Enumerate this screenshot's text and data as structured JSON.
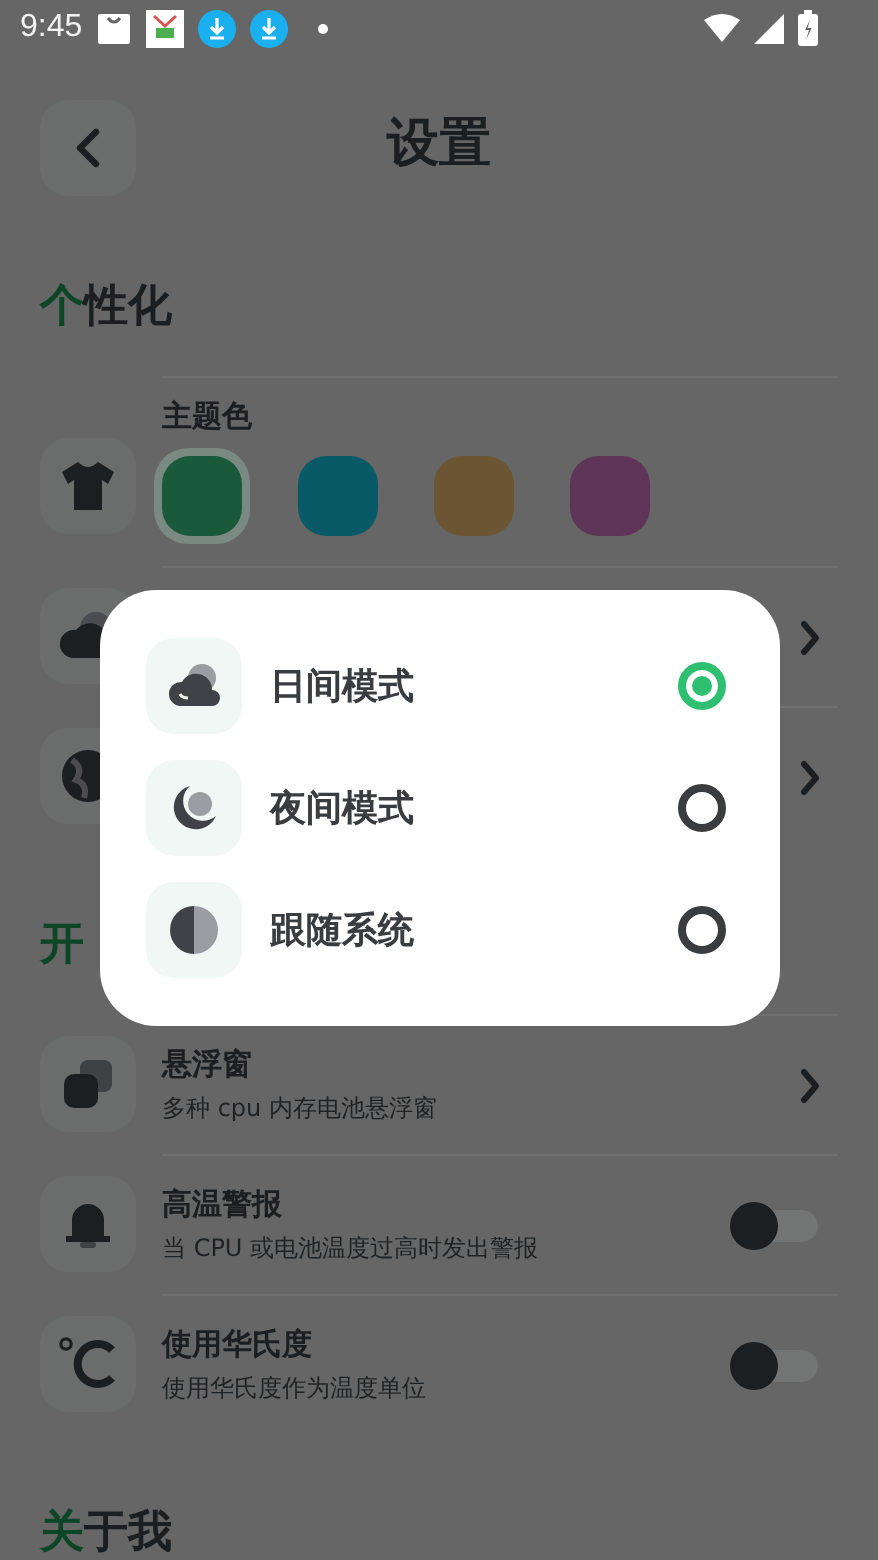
{
  "status_bar": {
    "time": "9:45"
  },
  "header": {
    "title": "设置"
  },
  "sections": [
    {
      "title_accent": "个",
      "title_rest": "性化",
      "rows": [
        {
          "kind": "colors",
          "label": "主题色",
          "swatches": [
            {
              "color": "#1a5a3a",
              "selected": true
            },
            {
              "color": "#075a66",
              "selected": false
            },
            {
              "color": "#6b5533",
              "selected": false
            },
            {
              "color": "#5e3558",
              "selected": false
            }
          ]
        },
        {
          "kind": "nav"
        },
        {
          "kind": "nav"
        }
      ]
    },
    {
      "title_accent": "开",
      "rows": [
        {
          "kind": "nav",
          "title": "悬浮窗",
          "subtitle": "多种 cpu 内存电池悬浮窗"
        },
        {
          "kind": "toggle",
          "title": "高温警报",
          "subtitle": "当 CPU 或电池温度过高时发出警报",
          "on": false
        },
        {
          "kind": "toggle",
          "title": "使用华氏度",
          "subtitle": "使用华氏度作为温度单位",
          "on": false
        }
      ]
    },
    {
      "title_accent": "关",
      "title_rest": "于我"
    }
  ],
  "dialog": {
    "options": [
      {
        "label": "日间模式",
        "selected": true
      },
      {
        "label": "夜间模式",
        "selected": false
      },
      {
        "label": "跟随系统",
        "selected": false
      }
    ]
  }
}
